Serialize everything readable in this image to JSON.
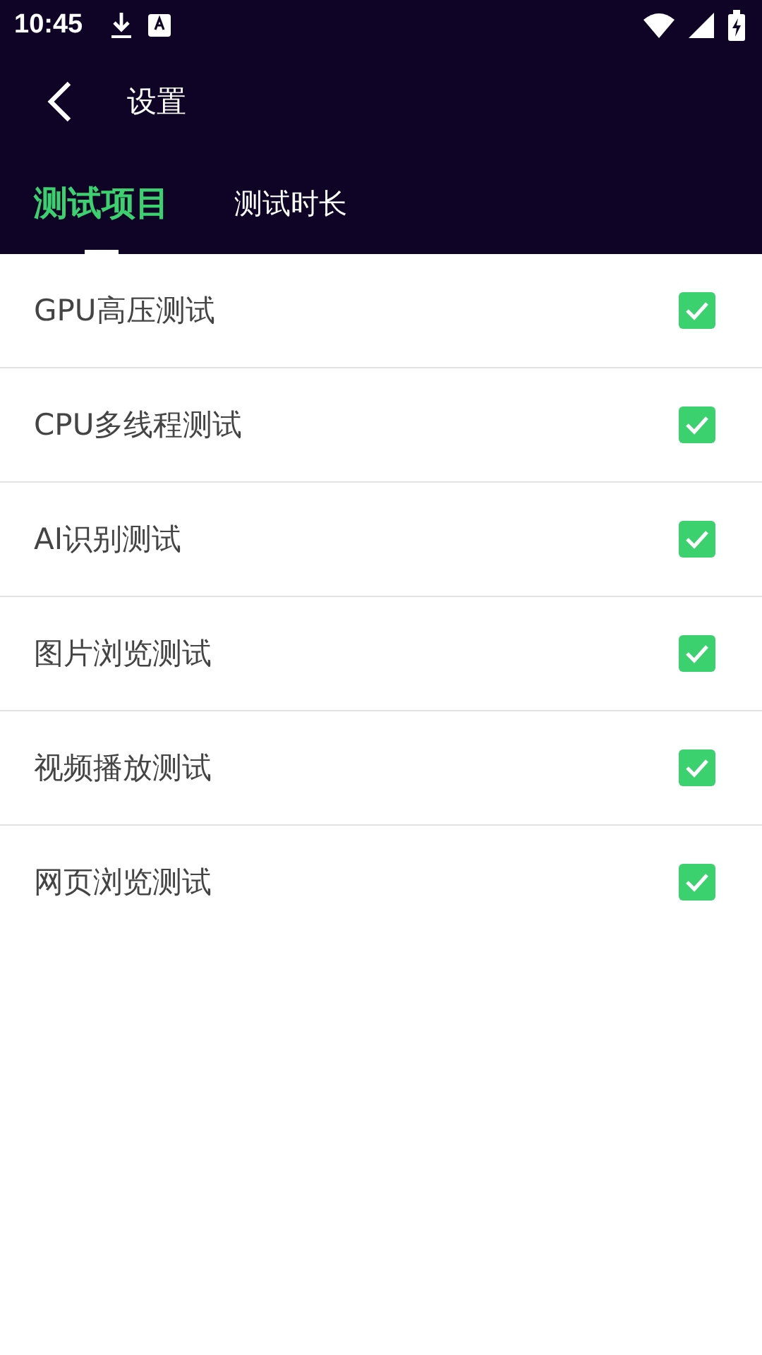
{
  "status_bar": {
    "time": "10:45"
  },
  "header": {
    "title": "设置"
  },
  "tabs": [
    {
      "label": "测试项目",
      "selected": true
    },
    {
      "label": "测试时长",
      "selected": false
    }
  ],
  "items": [
    {
      "label": "GPU高压测试",
      "checked": true
    },
    {
      "label": "CPU多线程测试",
      "checked": true
    },
    {
      "label": "AI识别测试",
      "checked": true
    },
    {
      "label": "图片浏览测试",
      "checked": true
    },
    {
      "label": "视频播放测试",
      "checked": true
    },
    {
      "label": "网页浏览测试",
      "checked": true
    }
  ]
}
